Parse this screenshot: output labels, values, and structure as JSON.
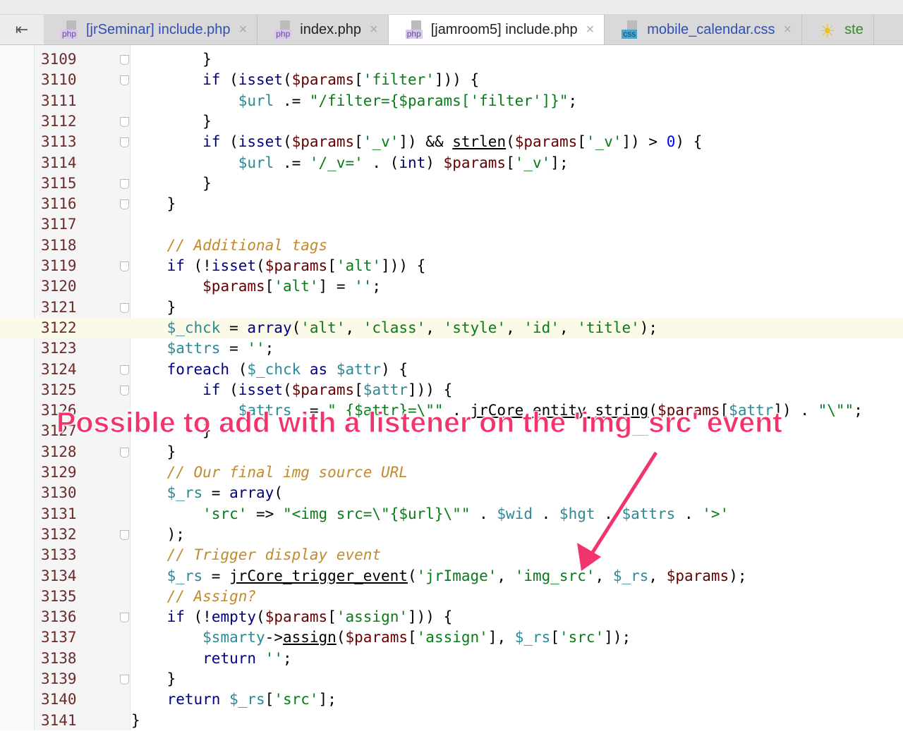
{
  "tabs": [
    {
      "icon": "php",
      "label": "[jrSeminar] include.php",
      "color": "#2f50b0",
      "active": false
    },
    {
      "icon": "php",
      "label": "index.php",
      "color": "#222222",
      "active": false
    },
    {
      "icon": "php",
      "label": "[jamroom5] include.php",
      "color": "#222222",
      "active": true
    },
    {
      "icon": "css",
      "label": "mobile_calendar.css",
      "color": "#2f50b0",
      "active": false
    },
    {
      "icon": "sun",
      "label": "ste",
      "color": "#3a8a2a",
      "active": false
    }
  ],
  "collapse_icon": "collapse-left-icon",
  "current_line": 3122,
  "first_line": 3109,
  "lines": [
    "        }",
    "        if (isset($params['filter'])) {",
    "            $url .= \"/filter={$params['filter']}\";",
    "        }",
    "        if (isset($params['_v']) && strlen($params['_v']) > 0) {",
    "            $url .= '/_v=' . (int) $params['_v'];",
    "        }",
    "    }",
    "",
    "    // Additional tags",
    "    if (!isset($params['alt'])) {",
    "        $params['alt'] = '';",
    "    }",
    "    $_chck = array('alt', 'class', 'style', 'id', 'title');",
    "    $attrs = '';",
    "    foreach ($_chck as $attr) {",
    "        if (isset($params[$attr])) {",
    "            $attrs .= \" {$attr}=\\\"\" . jrCore_entity_string($params[$attr]) . \"\\\"\";",
    "        }",
    "    }",
    "    // Our final img source URL",
    "    $_rs = array(",
    "        'src' => \"<img src=\\\"{$url}\\\"\" . $wid . $hgt . $attrs . '>'",
    "    );",
    "    // Trigger display event",
    "    $_rs = jrCore_trigger_event('jrImage', 'img_src', $_rs, $params);",
    "    // Assign?",
    "    if (!empty($params['assign'])) {",
    "        $smarty->assign($params['assign'], $_rs['src']);",
    "        return '';",
    "    }",
    "    return $_rs['src'];",
    "}"
  ],
  "fold_lines": [
    3109,
    3110,
    3112,
    3113,
    3115,
    3116,
    3119,
    3121,
    3124,
    3125,
    3128,
    3132,
    3136,
    3139
  ],
  "annotation": {
    "text": "Possible to add with a listener on the 'img_src' event",
    "color": "#f2346c"
  }
}
